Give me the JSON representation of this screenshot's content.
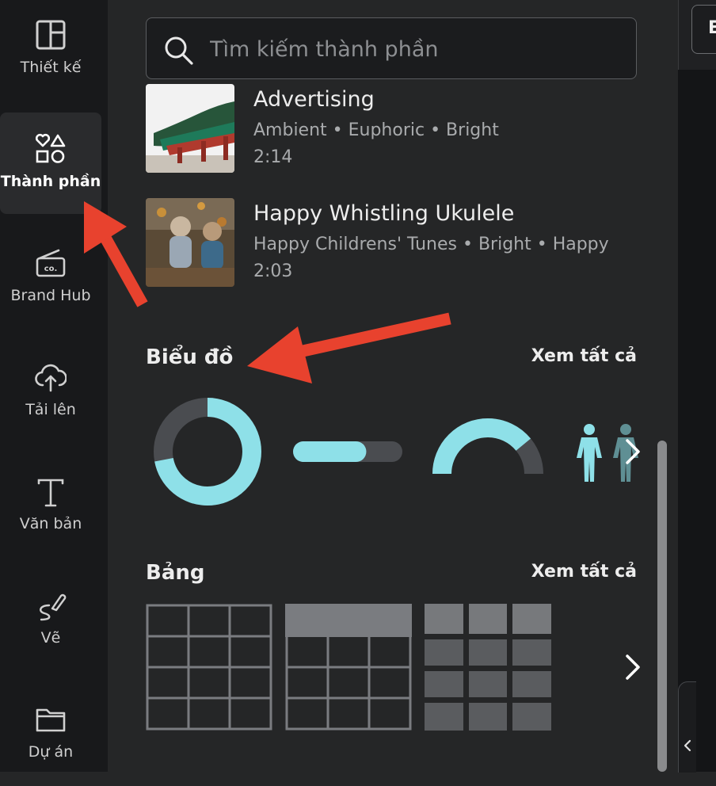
{
  "sidebar": {
    "items": [
      {
        "label": "Thiết kế",
        "icon": "layout-icon"
      },
      {
        "label": "Thành phần",
        "icon": "shapes-icon"
      },
      {
        "label": "Brand Hub",
        "icon": "brand-icon"
      },
      {
        "label": "Tải lên",
        "icon": "cloud-upload-icon"
      },
      {
        "label": "Văn bản",
        "icon": "text-icon"
      },
      {
        "label": "Vẽ",
        "icon": "draw-icon"
      },
      {
        "label": "Dự án",
        "icon": "folder-icon"
      }
    ]
  },
  "search": {
    "placeholder": "Tìm kiếm thành phần",
    "value": ""
  },
  "tracks": [
    {
      "title": "Advertising",
      "meta": "Ambient • Euphoric • Bright",
      "duration": "2:14"
    },
    {
      "title": "Happy Whistling Ukulele",
      "meta": "Happy Childrens' Tunes • Bright • Happy",
      "duration": "2:03"
    }
  ],
  "charts_section": {
    "title": "Biểu đồ",
    "see_all": "Xem tất cả",
    "items": [
      {
        "kind": "donut",
        "progress": 0.72
      },
      {
        "kind": "progress-bar",
        "progress": 0.67
      },
      {
        "kind": "half-gauge",
        "progress": 0.78
      },
      {
        "kind": "people",
        "count": 2
      }
    ]
  },
  "tables_section": {
    "title": "Bảng",
    "see_all": "Xem tất cả"
  },
  "topbar": {
    "partial_button": "E"
  },
  "colors": {
    "accent_teal": "#8ee0e8",
    "track_gray": "#4a4c50",
    "annotation_red": "#e8422e",
    "rail_bg": "#18191b",
    "panel_bg": "#252627"
  }
}
